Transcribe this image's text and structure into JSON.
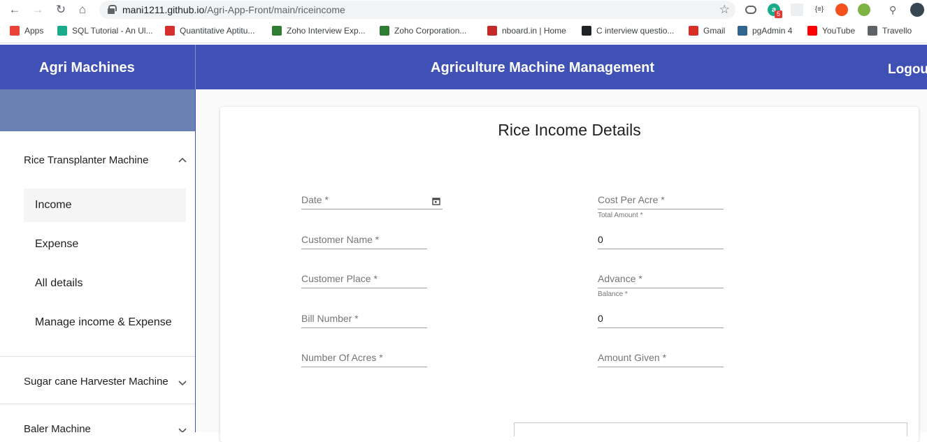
{
  "browser": {
    "url_host": "mani1211.github.io",
    "url_path": "/Agri-App-Front/main/riceincome",
    "bookmarks": [
      {
        "label": "Apps",
        "color": "#ea4335"
      },
      {
        "label": "SQL Tutorial - An Ul...",
        "color": "#1aab8a"
      },
      {
        "label": "Quantitative Aptitu...",
        "color": "#d32f2f"
      },
      {
        "label": "Zoho Interview Exp...",
        "color": "#2e7d32"
      },
      {
        "label": "Zoho Corporation...",
        "color": "#2e7d32"
      },
      {
        "label": "nboard.in | Home",
        "color": "#c62828"
      },
      {
        "label": "C interview questio...",
        "color": "#202124"
      },
      {
        "label": "Gmail",
        "color": "#d93025"
      },
      {
        "label": "pgAdmin 4",
        "color": "#326690"
      },
      {
        "label": "YouTube",
        "color": "#ff0000"
      },
      {
        "label": "Travello",
        "color": "#5f6368"
      }
    ],
    "extension_badge": "5"
  },
  "header": {
    "brand": "Agri Machines",
    "title": "Agriculture Machine Management",
    "logout": "Logou"
  },
  "sidebar": {
    "panels": [
      {
        "label": "Rice Transplanter Machine",
        "expanded": true
      },
      {
        "label": "Sugar cane Harvester Machine",
        "expanded": false
      },
      {
        "label": "Baler Machine",
        "expanded": false
      }
    ],
    "items": [
      {
        "label": "Income",
        "active": true
      },
      {
        "label": "Expense",
        "active": false
      },
      {
        "label": "All details",
        "active": false
      },
      {
        "label": "Manage income & Expense",
        "active": false
      }
    ]
  },
  "form": {
    "title": "Rice Income Details",
    "date": {
      "placeholder": "Date *"
    },
    "customer_name": {
      "placeholder": "Customer Name *"
    },
    "customer_place": {
      "placeholder": "Customer Place *"
    },
    "bill_number": {
      "placeholder": "Bill Number *"
    },
    "number_of_acres": {
      "placeholder": "Number Of Acres *"
    },
    "cost_per_acre": {
      "placeholder": "Cost Per Acre *"
    },
    "total_amount": {
      "label": "Total Amount *",
      "value": "0"
    },
    "advance": {
      "placeholder": "Advance *"
    },
    "balance": {
      "label": "Balance *",
      "value": "0"
    },
    "amount_given": {
      "placeholder": "Amount Given *"
    }
  },
  "colors": {
    "primary": "#3f51b5",
    "sidebar_banner": "#6b80b3"
  }
}
